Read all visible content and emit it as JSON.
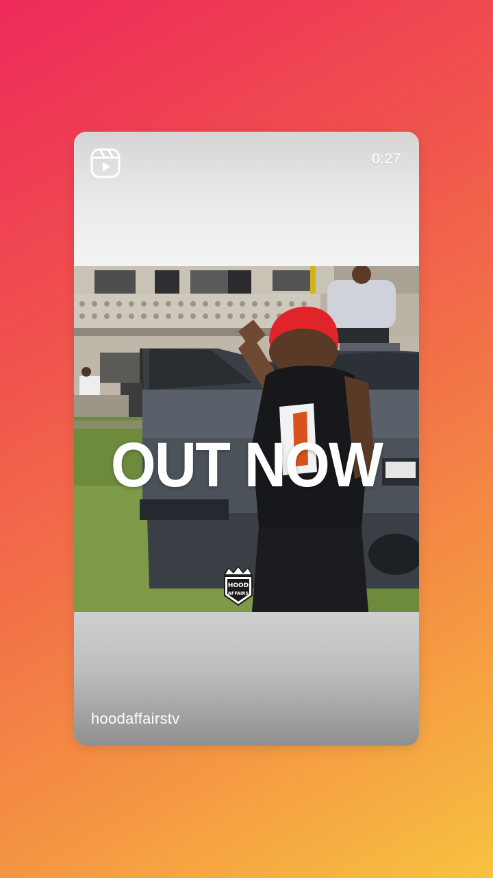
{
  "reel": {
    "duration": "0:27",
    "username": "hoodaffairstv",
    "overlay_text": "OUT NOW",
    "watermark_text": "HOOD AFFAIRS",
    "type_icon": "reels-icon"
  },
  "colors": {
    "gradient_start": "#ee2a5a",
    "gradient_end": "#f7c241",
    "hair_red": "#e0242a"
  }
}
